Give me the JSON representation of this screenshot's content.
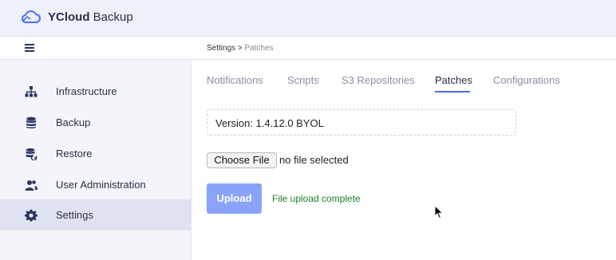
{
  "app": {
    "brand_bold": "YCloud",
    "brand_light": " Backup"
  },
  "breadcrumb": {
    "parent": "Settings",
    "separator": " > ",
    "current": "Patches"
  },
  "sidebar": {
    "items": [
      {
        "label": "Infrastructure",
        "icon": "sitemap-icon"
      },
      {
        "label": "Backup",
        "icon": "database-icon"
      },
      {
        "label": "Restore",
        "icon": "database-restore-icon"
      },
      {
        "label": "User Administration",
        "icon": "users-icon"
      },
      {
        "label": "Settings",
        "icon": "gear-icon",
        "active": true
      }
    ]
  },
  "tabs": [
    {
      "label": "Notifications"
    },
    {
      "label": "Scripts"
    },
    {
      "label": "S3 Repositories"
    },
    {
      "label": "Patches",
      "active": true
    },
    {
      "label": "Configurations"
    }
  ],
  "main": {
    "version_text": "Version: 1.4.12.0 BYOL",
    "choose_file_label": "Choose File",
    "file_status": "no file selected",
    "upload_label": "Upload",
    "upload_message": "File upload complete"
  },
  "colors": {
    "accent": "#4a6cf7",
    "upload_button": "#8aa2f7",
    "success_text": "#1e7d2b"
  }
}
